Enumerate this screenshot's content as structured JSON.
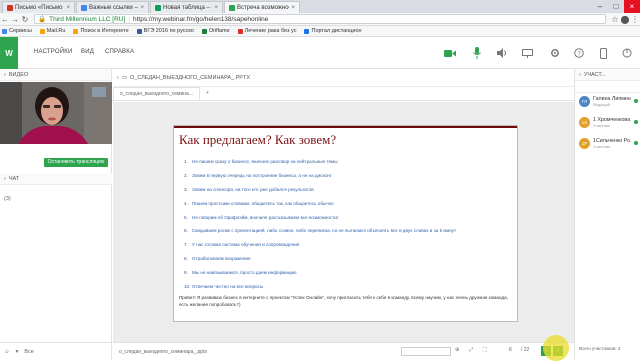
{
  "browser": {
    "tabs": [
      {
        "label": "Письмо «Письмо пос",
        "fav": "#d93025"
      },
      {
        "label": "Важные ссылки – Goog",
        "fav": "#4285f4"
      },
      {
        "label": "Новая таблица – Goog",
        "fav": "#0f9d58"
      },
      {
        "label": "Встреча возможностей",
        "fav": "#2ea44f"
      }
    ],
    "address_site": "Third Millennium LLC [RU]",
    "address_url": "https://my.webinar.fm/go/helen138/sapehonline",
    "bookmarks": [
      {
        "label": "Сервисы",
        "color": "#4285f4"
      },
      {
        "label": "Mail.Ru",
        "color": "#f7a600"
      },
      {
        "label": "Поиск в Интернете",
        "color": "#f7a600"
      },
      {
        "label": "ВГЭ 2016 по русско",
        "color": "#3b5998"
      },
      {
        "label": "Oriflame",
        "color": "#1a7f37"
      },
      {
        "label": "Лечение рака без ус",
        "color": "#d93025"
      },
      {
        "label": "Портал дистанцион",
        "color": "#1a73e8"
      }
    ]
  },
  "app": {
    "menu": [
      "НАСТРОЙКИ",
      "ВИД",
      "СПРАВКА"
    ],
    "left": {
      "video_label": "ВИДЕО",
      "stop_button": "Остановить трансляцию",
      "chat_label": "ЧАТ",
      "chat_count": "(3)",
      "chat_all": "Все"
    },
    "center": {
      "panel_label": "О_СЛЕДАН_ВЫЕЗДНОГО_СЕМИНАРА_.PPTX",
      "doc_tab": "о_следан_выездного_семина...",
      "add_tab": "+",
      "slide": {
        "title": "Как предлагаем? Как зовем?",
        "items": [
          {
            "n": "1.",
            "t": "Не пишем сразу о бизнесе, вначале разговор на нейтральные темы"
          },
          {
            "n": "2.",
            "t": "Зовем в первую очередь на построение бизнеса, а не на дисконт"
          },
          {
            "n": "3.",
            "t": "Зовем на спонсоря, на того кто уже добился результатов"
          },
          {
            "n": "4.",
            "t": "Пишем простыми словами, общаетесь так, как общаетесь обычно"
          },
          {
            "n": "5.",
            "t": "Не говорим об Орифлэйм, вначале рассказываем все возможности!"
          },
          {
            "n": "6.",
            "t": "Скидываем ролик с презентацией, либо созвон, либо переписка, но не пытаемся объяснять все в двух словах и за 5 минут"
          },
          {
            "n": "7.",
            "t": "У нас готовая система обучения и сопровождения"
          },
          {
            "n": "8.",
            "t": "Отрабатываем возражения"
          },
          {
            "n": "9.",
            "t": "Мы не навязываемся, просто даем информацию"
          },
          {
            "n": "10.",
            "t": "Отвечаем честно на все вопросы"
          }
        ],
        "footer": "Привет! Я развиваю бизнес в интернете с проектом \"Успех Онлайн\", хочу пригласить тебя к себе в команду, всему научим, у нас очень дружная команда, есть желание попробовать?)"
      },
      "pager_file": "о_следан_выездного_семинара_.pptx",
      "page_current": "6",
      "page_total": "/ 22"
    },
    "right": {
      "label": "УЧАСТ...",
      "participants": [
        {
          "name": "Галина Липкина",
          "role": "Ведущий",
          "initials": "ГЛ",
          "color": "#4a86c5"
        },
        {
          "name": "1 Хромченкова ...",
          "role": "Участник",
          "initials": "1Х",
          "color": "#e3a02a"
        },
        {
          "name": "1Сильченко Ро...",
          "role": "Участник",
          "initials": "1Р",
          "color": "#e3a02a"
        }
      ],
      "footer": "Всего участников: 3"
    }
  }
}
